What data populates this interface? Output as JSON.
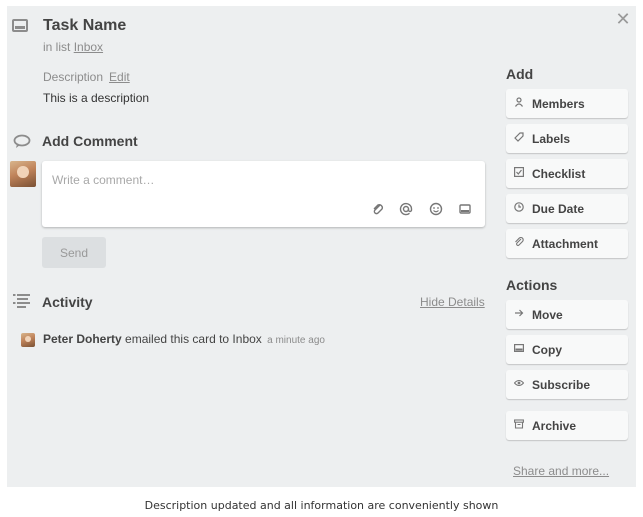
{
  "card": {
    "title": "Task Name",
    "in_list_prefix": "in list",
    "list_name": "Inbox",
    "description_label": "Description",
    "description_edit": "Edit",
    "description_text": "This is a description"
  },
  "comment": {
    "section_title": "Add Comment",
    "placeholder": "Write a comment…",
    "send_label": "Send",
    "tools": [
      "attachment-icon",
      "mention-icon",
      "emoji-icon",
      "card-icon"
    ]
  },
  "activity": {
    "section_title": "Activity",
    "hide_details": "Hide Details",
    "items": [
      {
        "user": "Peter Doherty",
        "text": "emailed this card to Inbox",
        "time": "a minute ago"
      }
    ]
  },
  "sidebar": {
    "add_title": "Add",
    "add_buttons": [
      {
        "label": "Members",
        "icon": "person-icon"
      },
      {
        "label": "Labels",
        "icon": "tag-icon"
      },
      {
        "label": "Checklist",
        "icon": "checkbox-icon"
      },
      {
        "label": "Due Date",
        "icon": "clock-icon"
      },
      {
        "label": "Attachment",
        "icon": "paperclip-icon"
      }
    ],
    "actions_title": "Actions",
    "action_buttons": [
      {
        "label": "Move",
        "icon": "arrow-right-icon"
      },
      {
        "label": "Copy",
        "icon": "card-icon"
      },
      {
        "label": "Subscribe",
        "icon": "eye-icon"
      },
      {
        "label": "Archive",
        "icon": "archive-icon"
      }
    ],
    "share_link": "Share and more..."
  },
  "caption": "Description updated and all information are conveniently shown"
}
